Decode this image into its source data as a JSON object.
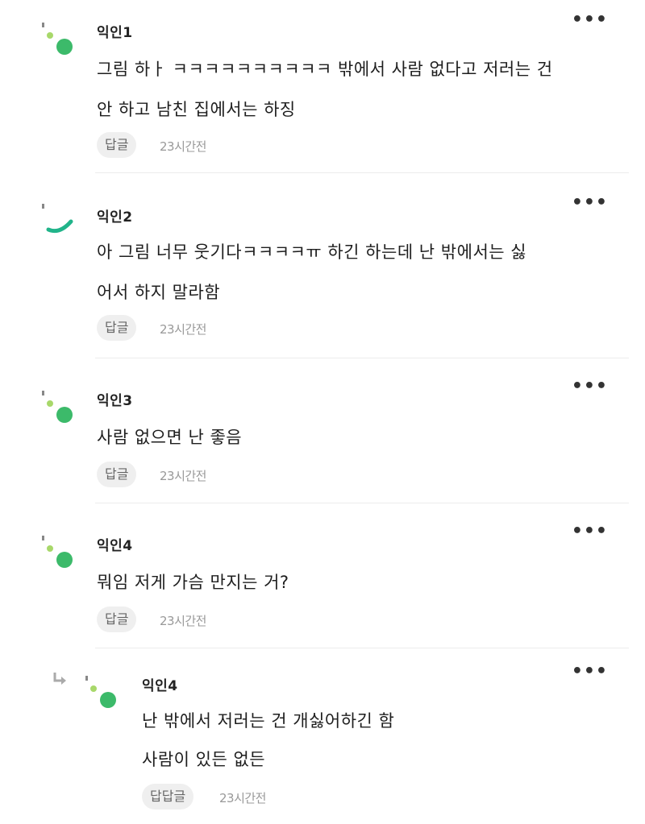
{
  "comments": [
    {
      "author": "익인1",
      "lines": [
        "그림 하ㅏ ㅋㅋㅋㅋㅋㅋㅋㅋㅋㅋ 밖에서 사람 없다고 저러는 건",
        "안 하고 남친 집에서는 하징"
      ],
      "reply_label": "답글",
      "time": "23시간전",
      "more": "•••"
    },
    {
      "author": "익인2",
      "lines": [
        "아 그림 너무 웃기다ㅋㅋㅋㅋㅠ 하긴 하는데 난 밖에서는 싫",
        "어서 하지 말라함"
      ],
      "reply_label": "답글",
      "time": "23시간전",
      "more": "•••"
    },
    {
      "author": "익인3",
      "lines": [
        "사람 없으면 난 좋음"
      ],
      "reply_label": "답글",
      "time": "23시간전",
      "more": "•••"
    },
    {
      "author": "익인4",
      "lines": [
        "뭐임 저게 가슴 만지는 거?"
      ],
      "reply_label": "답글",
      "time": "23시간전",
      "more": "•••"
    },
    {
      "author": "익인4",
      "lines": [
        "난 밖에서 저러는 건 개싫어하긴 함",
        "사람이 있든 없든"
      ],
      "reply_label": "답답글",
      "time": "23시간전",
      "more": "•••"
    }
  ],
  "icons": {
    "avatar": "avatar-dots-icon",
    "reply_arrow": "reply-arrow-icon",
    "more": "more-options-icon"
  },
  "colors": {
    "accent_green": "#3cba6a"
  }
}
